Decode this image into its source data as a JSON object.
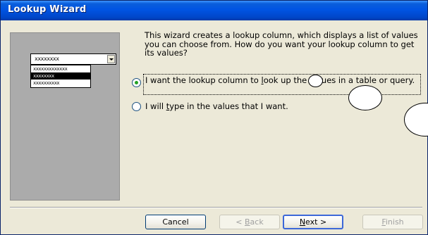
{
  "window": {
    "title": "Lookup Wizard"
  },
  "preview": {
    "combo_value": "xxxxxxxx",
    "list_items": [
      "xxxxxxxxxxxxx",
      "xxxxxxxx",
      "xxxxxxxxxx"
    ]
  },
  "description": "This wizard creates a lookup column, which displays a list of values you can choose from.  How do you want your lookup column to get its values?",
  "options": [
    {
      "pre": "I want the lookup column to ",
      "hotkey": "l",
      "post": "ook up the values in a table or query.",
      "selected": true
    },
    {
      "pre": "I will ",
      "hotkey": "t",
      "post": "ype in the values that I want.",
      "selected": false
    }
  ],
  "buttons": {
    "cancel": "Cancel",
    "back": "< Back",
    "next": "Next >",
    "finish": "Finish"
  },
  "colors": {
    "title_bar": "#0054E3",
    "dialog_bg": "#ECE9D8",
    "panel": "#ABABAB",
    "radio_dot": "#21A121"
  }
}
